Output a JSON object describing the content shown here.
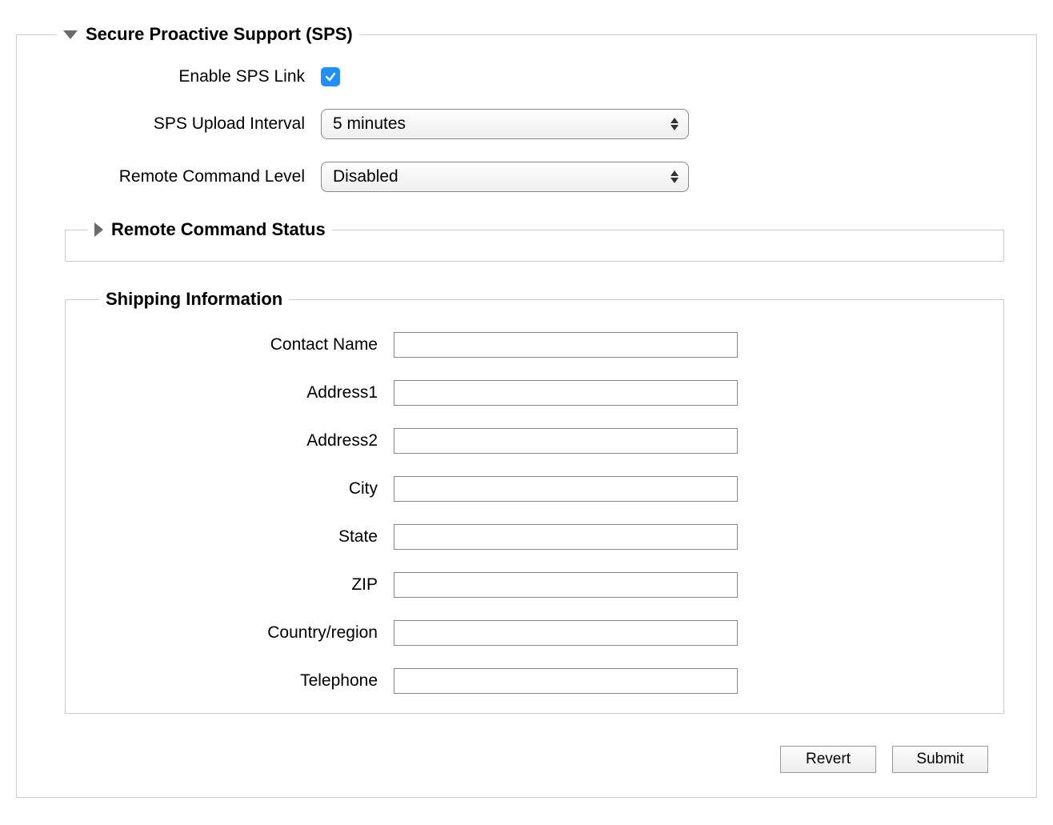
{
  "sps": {
    "title": "Secure Proactive Support (SPS)",
    "enable_label": "Enable SPS Link",
    "enable_checked": true,
    "upload_interval_label": "SPS Upload Interval",
    "upload_interval_value": "5 minutes",
    "remote_cmd_level_label": "Remote Command Level",
    "remote_cmd_level_value": "Disabled",
    "remote_cmd_status_title": "Remote Command Status"
  },
  "shipping": {
    "title": "Shipping Information",
    "fields": {
      "contact_name": {
        "label": "Contact Name",
        "value": ""
      },
      "address1": {
        "label": "Address1",
        "value": ""
      },
      "address2": {
        "label": "Address2",
        "value": ""
      },
      "city": {
        "label": "City",
        "value": ""
      },
      "state": {
        "label": "State",
        "value": ""
      },
      "zip": {
        "label": "ZIP",
        "value": ""
      },
      "country": {
        "label": "Country/region",
        "value": ""
      },
      "telephone": {
        "label": "Telephone",
        "value": ""
      }
    }
  },
  "actions": {
    "revert": "Revert",
    "submit": "Submit"
  }
}
